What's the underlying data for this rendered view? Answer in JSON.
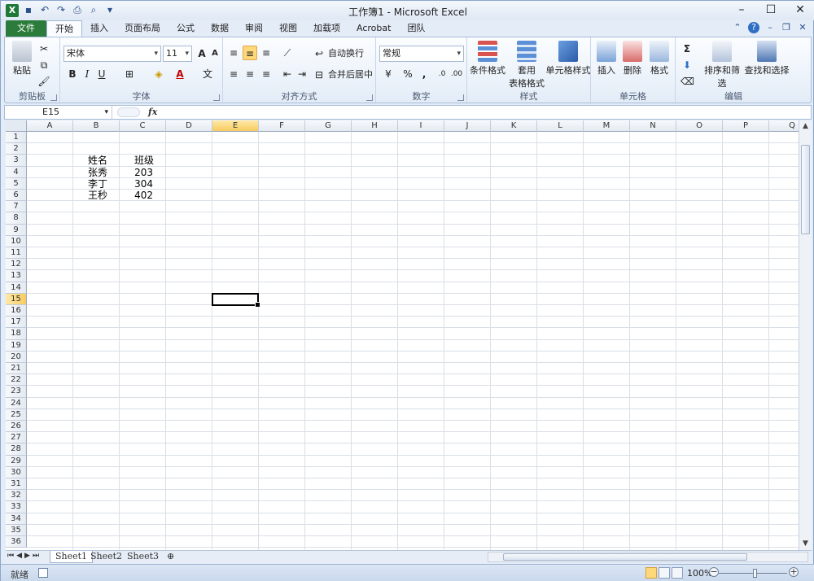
{
  "app": {
    "title": "工作簿1 - Microsoft Excel",
    "icon": "X"
  },
  "tabs": [
    "文件",
    "开始",
    "插入",
    "页面布局",
    "公式",
    "数据",
    "审阅",
    "视图",
    "加载项",
    "Acrobat",
    "团队"
  ],
  "ribbon": {
    "clipboard": {
      "label": "剪贴板",
      "paste": "粘贴"
    },
    "font": {
      "label": "字体",
      "font_name": "宋体",
      "font_size": "11"
    },
    "alignment": {
      "label": "对齐方式",
      "wrap": "自动换行",
      "merge": "合并后居中"
    },
    "number": {
      "label": "数字",
      "format": "常规"
    },
    "styles": {
      "label": "样式",
      "conditional": "条件格式",
      "table_line1": "套用",
      "table_line2": "表格格式",
      "cell_styles": "单元格样式"
    },
    "cells": {
      "label": "单元格",
      "insert": "插入",
      "delete": "删除",
      "format": "格式"
    },
    "editing": {
      "label": "编辑",
      "sort": "排序和筛选",
      "find": "查找和选择"
    }
  },
  "formula_bar": {
    "name_box": "E15",
    "fx": "fx",
    "content": ""
  },
  "columns": [
    "A",
    "B",
    "C",
    "D",
    "E",
    "F",
    "G",
    "H",
    "I",
    "J",
    "K",
    "L",
    "M",
    "N",
    "O",
    "P",
    "Q"
  ],
  "selected_column": "E",
  "selected_row": 15,
  "row_count": 36,
  "cells": {
    "B3": "姓名",
    "C3": "班级",
    "B4": "张秀",
    "C4": "203",
    "B5": "李丁",
    "C5": "304",
    "B6": "王秒",
    "C6": "402"
  },
  "sheet_tabs": [
    "Sheet1",
    "Sheet2",
    "Sheet3"
  ],
  "status": {
    "ready": "就绪",
    "zoom": "100%"
  }
}
